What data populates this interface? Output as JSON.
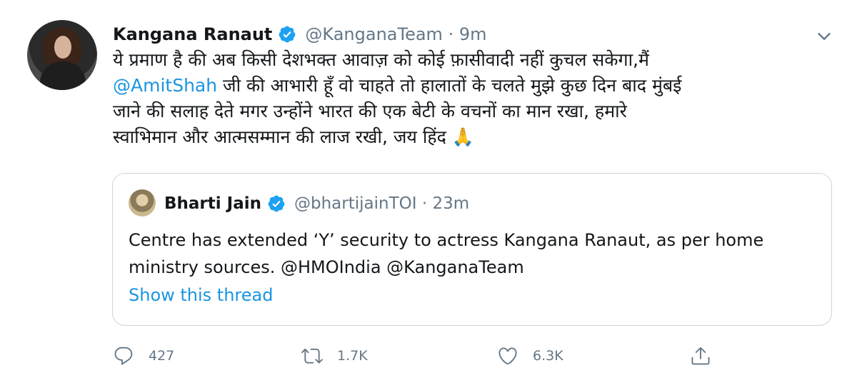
{
  "tweet": {
    "author_name": "Kangana Ranaut",
    "handle_time": "@KanganaTeam · 9m",
    "text_lines": [
      "ये प्रमाण है की अब किसी देशभक्त आवाज़ को कोई फ़ासीवादी नहीं कुचल सकेगा,मैं",
      "जी की आभारी हूँ वो चाहते तो हालातों के चलते मुझे कुछ दिन बाद मुंबई",
      "जाने की सलाह देते मगर उन्होंने भारत की एक बेटी के वचनों का मान रखा, हमारे",
      "स्वाभिमान और आत्मसम्मान की लाज रखी, जय हिंद 🙏"
    ],
    "mention": "@AmitShah"
  },
  "quote": {
    "author_name": "Bharti Jain",
    "handle_time": "@bhartijainTOI · 23m",
    "text_lines": [
      "Centre has extended ‘Y’ security to actress Kangana Ranaut, as per home",
      "ministry sources. @HMOIndia @KanganaTeam"
    ],
    "show_thread": "Show this thread"
  },
  "actions": {
    "replies": "427",
    "retweets": "1.7K",
    "likes": "6.3K"
  },
  "colors": {
    "accent": "#1b95e0",
    "muted": "#657786",
    "border": "#ccd6dd"
  },
  "icons": [
    "verified-icon",
    "chevron-down-icon",
    "reply-icon",
    "retweet-icon",
    "like-icon",
    "share-icon"
  ]
}
